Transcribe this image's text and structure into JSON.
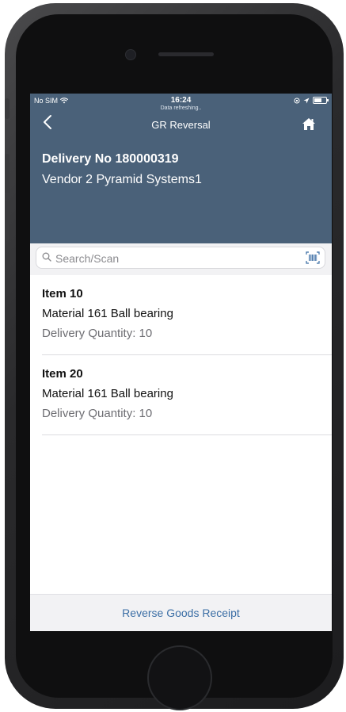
{
  "status_bar": {
    "carrier": "No SIM",
    "time": "16:24",
    "subtitle": "Data refreshing.."
  },
  "nav": {
    "back_icon": "chevron-left-icon",
    "title": "GR Reversal",
    "home_icon": "home-icon"
  },
  "header": {
    "delivery": "Delivery No 180000319",
    "vendor": "Vendor 2 Pyramid Systems1"
  },
  "search": {
    "placeholder": "Search/Scan",
    "value": ""
  },
  "items": [
    {
      "title": "Item 10",
      "material": "Material 161 Ball bearing",
      "quantity": "Delivery Quantity: 10"
    },
    {
      "title": "Item 20",
      "material": "Material 161 Ball bearing",
      "quantity": "Delivery Quantity: 10"
    }
  ],
  "footer": {
    "action_label": "Reverse Goods Receipt"
  },
  "colors": {
    "header_bg": "#4a6179",
    "link": "#3b6ea5"
  }
}
